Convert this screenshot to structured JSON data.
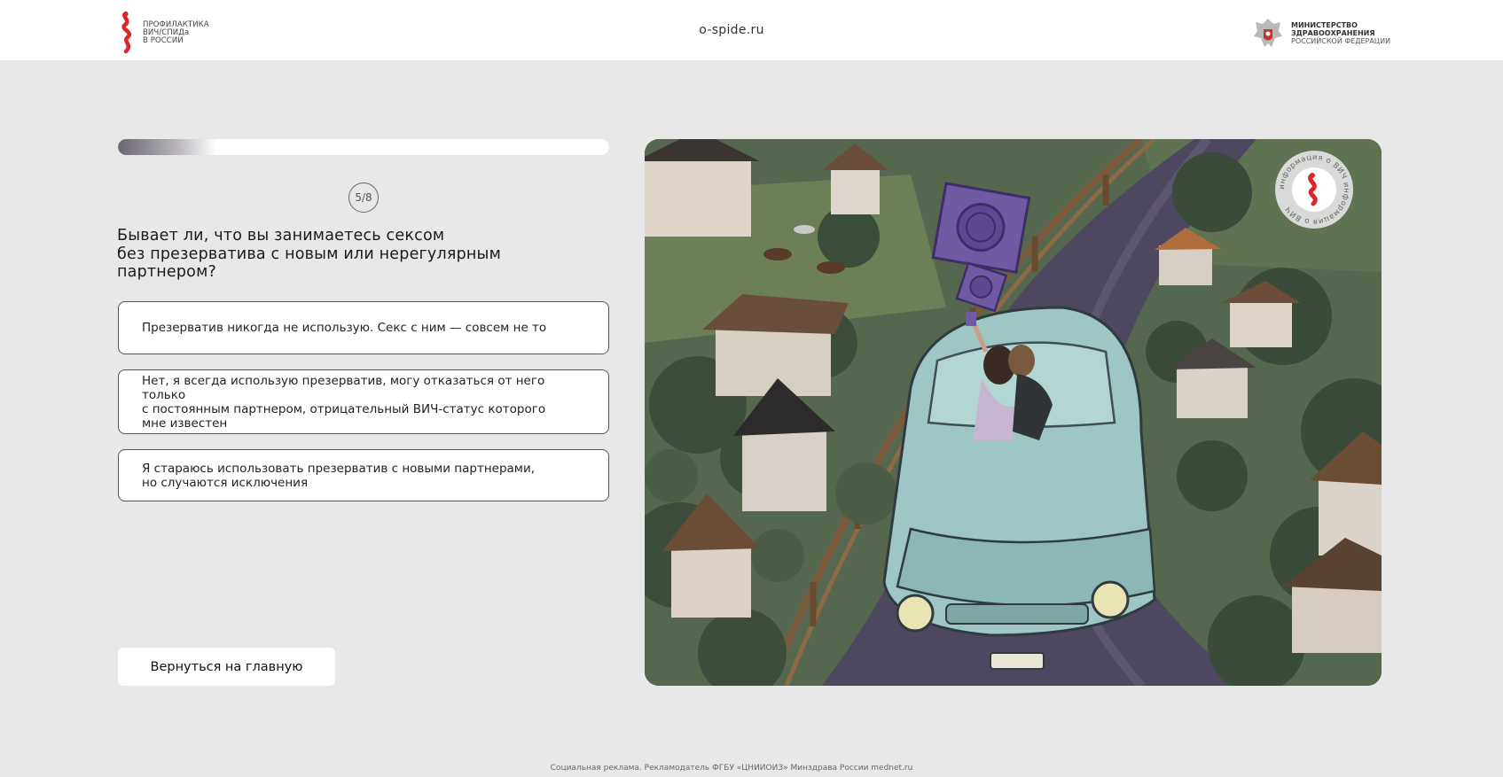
{
  "header": {
    "logo_left": {
      "line1": "ПРОФИЛАКТИКА",
      "line2": "ВИЧ/СПИДа",
      "line3": "В РОССИИ"
    },
    "site_url": "o-spide.ru",
    "logo_right": {
      "line1": "МИНИСТЕРСТВО",
      "line2": "ЗДРАВООХРАНЕНИЯ",
      "line3": "РОССИЙСКОЙ ФЕДЕРАЦИИ"
    }
  },
  "quiz": {
    "progress": 0.2,
    "step": "5/8",
    "question": "Бывает ли, что вы занимаетесь сексом\nбез презерватива с новым или нерегулярным\nпартнером?",
    "options": [
      {
        "label": "Презерватив никогда не использую. Секс с ним — совсем не то"
      },
      {
        "label": "Нет, я всегда использую презерватив, могу отказаться от него только\nс постоянным партнером, отрицательный ВИЧ-статус которого\nмне известен"
      },
      {
        "label": "Я стараюсь использовать презерватив с новыми партнерами,\nно случаются исключения"
      }
    ],
    "back_button": "Вернуться на главную"
  },
  "illustration": {
    "stamp_text": "информация о ВИЧ информация о ВИЧ"
  },
  "footer": {
    "text": "Социальная реклама. Рекламодатель ФГБУ «ЦНИИОИЗ» Минздрава России mednet.ru"
  },
  "colors": {
    "background": "#e8e8e8",
    "accent_red": "#d9262b",
    "border": "#555555"
  }
}
